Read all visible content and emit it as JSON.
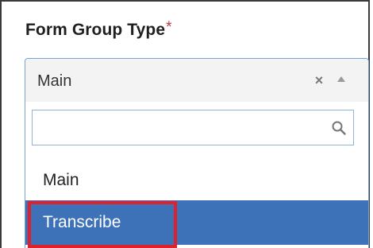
{
  "field": {
    "label": "Form Group Type",
    "required_mark": "*"
  },
  "select": {
    "selected_value": "Main",
    "clear_glyph": "×",
    "search": {
      "value": "",
      "placeholder": ""
    },
    "options": [
      {
        "label": "Main",
        "highlighted": false
      },
      {
        "label": "Transcribe",
        "highlighted": true
      }
    ]
  },
  "icons": {
    "clear": "close-icon",
    "caret": "caret-up-icon",
    "search": "search-icon"
  },
  "colors": {
    "required_mark": "#b63a3a",
    "select_border": "#77a2d4",
    "highlighted_option_bg": "#3d71b8",
    "annotation_box": "#e0202a"
  }
}
